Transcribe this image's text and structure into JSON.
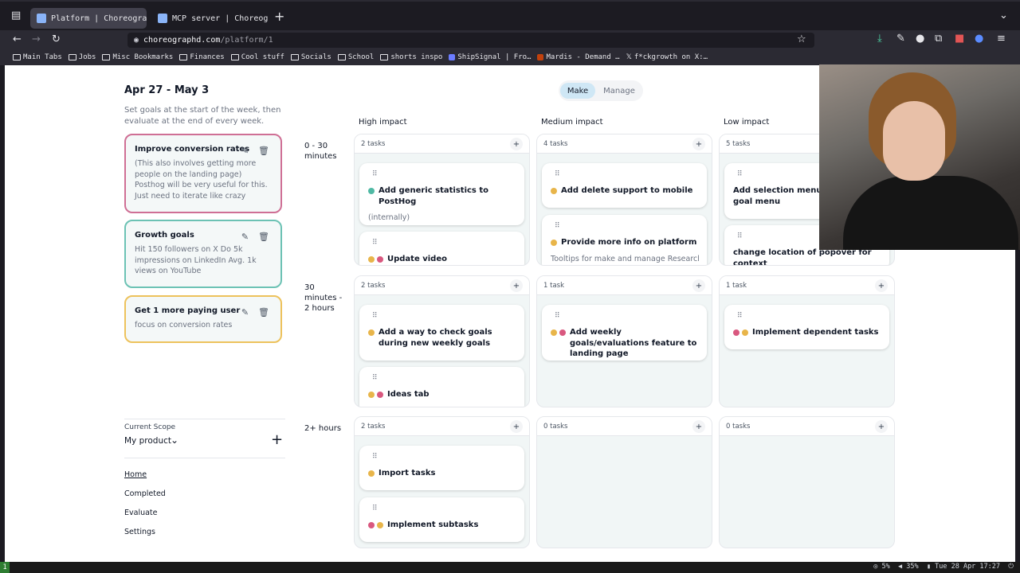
{
  "browser": {
    "tabs": [
      {
        "title": "Platform | Choreographd",
        "active": true
      },
      {
        "title": "MCP server | Choreograp",
        "active": false
      }
    ],
    "url_host": "choreographd.com",
    "url_path": "/platform/1",
    "bookmarks": [
      {
        "label": "Main Tabs",
        "icon": "folder-icon"
      },
      {
        "label": "Jobs",
        "icon": "folder-icon"
      },
      {
        "label": "Misc Bookmarks",
        "icon": "folder-icon"
      },
      {
        "label": "Finances",
        "icon": "folder-icon"
      },
      {
        "label": "Cool stuff",
        "icon": "folder-icon"
      },
      {
        "label": "Socials",
        "icon": "folder-icon"
      },
      {
        "label": "School",
        "icon": "folder-icon"
      },
      {
        "label": "shorts inspo",
        "icon": "folder-icon"
      },
      {
        "label": "ShipSignal | Fro…",
        "icon": "site-icon"
      },
      {
        "label": "Mardis - Demand …",
        "icon": "site-icon"
      },
      {
        "label": "f*ckgrowth on X:…",
        "icon": "x-icon"
      }
    ]
  },
  "header": {
    "week_range": "Apr 27 - May 3",
    "subtitle": "Set goals at the start of the week, then evaluate at the end of every week.",
    "toggle": {
      "make": "Make",
      "manage": "Manage",
      "selected": "Make"
    }
  },
  "goals": [
    {
      "title": "Improve conversion rates",
      "description": "(This also involves getting more people on the landing page) Posthog will be very useful for this. Just need to iterate like crazy",
      "border_color": "#cf6f95"
    },
    {
      "title": "Growth goals",
      "description": "Hit 150 followers on X Do 5k impressions on LinkedIn Avg. 1k views on YouTube",
      "border_color": "#6cc2b4"
    },
    {
      "title": "Get 1 more paying user",
      "description": "focus on conversion rates",
      "border_color": "#edc25c"
    }
  ],
  "matrix": {
    "columns": [
      "High impact",
      "Medium impact",
      "Low impact"
    ],
    "rows": [
      "0 - 30 minutes",
      "30 minutes - 2 hours",
      "2+ hours"
    ],
    "cells": [
      {
        "count": "2 tasks",
        "tasks": [
          {
            "title": "Add generic statistics to PostHog",
            "desc": "(internally)",
            "dots": [
              "#4fb9a4"
            ]
          },
          {
            "title": "Update video",
            "desc": "",
            "dots": [
              "#e8b54a",
              "#d9587f"
            ]
          }
        ]
      },
      {
        "count": "4 tasks",
        "tasks": [
          {
            "title": "Add delete support to mobile",
            "desc": "",
            "dots": [
              "#e8b54a"
            ]
          },
          {
            "title": "Provide more info on platform",
            "desc": "Tooltips for make and manage Research …",
            "dots": [
              "#e8b54a"
            ]
          }
        ]
      },
      {
        "count": "5 tasks",
        "tasks": [
          {
            "title": "Add selection menu for weekly goal menu",
            "desc": "",
            "dots": []
          },
          {
            "title": "change location of popover for context",
            "desc": "",
            "dots": []
          }
        ]
      },
      {
        "count": "2 tasks",
        "tasks": [
          {
            "title": "Add a way to check goals during new weekly goals",
            "desc": "",
            "dots": [
              "#e8b54a"
            ]
          },
          {
            "title": "Ideas tab",
            "desc": "",
            "dots": [
              "#e8b54a",
              "#d9587f"
            ]
          }
        ]
      },
      {
        "count": "1 task",
        "tasks": [
          {
            "title": "Add weekly goals/evaluations feature to landing page",
            "desc": "",
            "dots": [
              "#e8b54a",
              "#d9587f"
            ]
          }
        ]
      },
      {
        "count": "1 task",
        "tasks": [
          {
            "title": "Implement dependent tasks",
            "desc": "",
            "dots": [
              "#d9587f",
              "#e8b54a"
            ]
          }
        ]
      },
      {
        "count": "2 tasks",
        "tasks": [
          {
            "title": "Import tasks",
            "desc": "",
            "dots": [
              "#e8b54a"
            ]
          },
          {
            "title": "Implement subtasks",
            "desc": "",
            "dots": [
              "#d9587f",
              "#e8b54a"
            ]
          }
        ]
      },
      {
        "count": "0 tasks",
        "tasks": []
      },
      {
        "count": "0 tasks",
        "tasks": []
      }
    ]
  },
  "sidebar": {
    "scope_label": "Current Scope",
    "scope_value": "My product",
    "nav": [
      "Home",
      "Completed",
      "Evaluate",
      "Settings"
    ],
    "active_nav": "Home"
  },
  "statusbar": {
    "workspace": "1",
    "cpu": "5%",
    "volume": "35%",
    "datetime": "Tue 28 Apr 17:27"
  }
}
